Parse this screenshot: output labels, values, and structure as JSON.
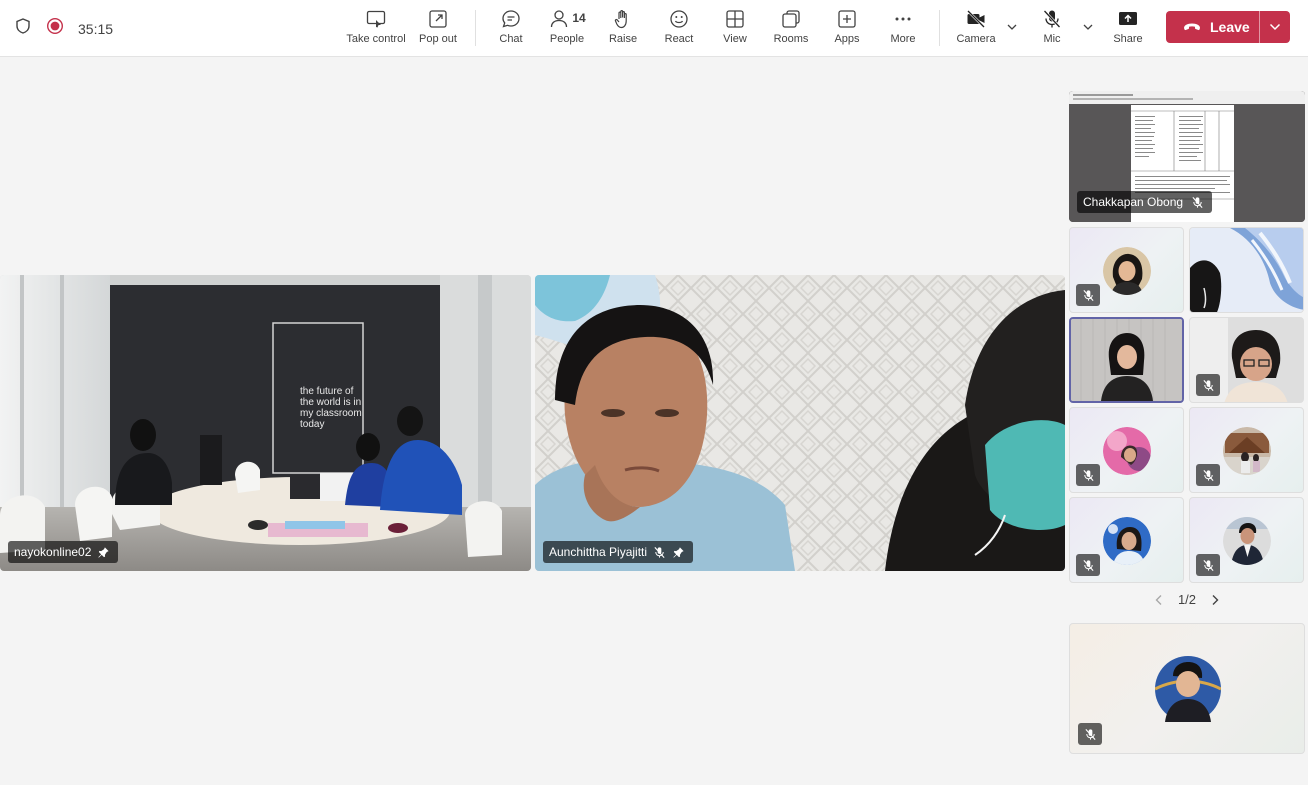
{
  "meeting": {
    "timer": "35:15",
    "shield_icon": "shield-icon",
    "record_icon": "recording-indicator-icon",
    "record_color": "#c4314b"
  },
  "toolbar": {
    "take_control": "Take control",
    "pop_out": "Pop out",
    "chat": "Chat",
    "people": "People",
    "people_count": "14",
    "raise": "Raise",
    "react": "React",
    "view": "View",
    "rooms": "Rooms",
    "apps": "Apps",
    "more": "More",
    "camera": "Camera",
    "mic": "Mic",
    "share": "Share",
    "leave": "Leave",
    "leave_color": "#c4314b"
  },
  "stage": {
    "tile1": {
      "name": "nayokonline02",
      "wall_text": "the future of the world is in my classroom today"
    },
    "tile2": {
      "name": "Aunchittha Piyajitti"
    }
  },
  "sidebar": {
    "screen_share": {
      "name": "Chakkapan Obong"
    },
    "pager": "1/2",
    "accent_color": "#6264a7"
  }
}
